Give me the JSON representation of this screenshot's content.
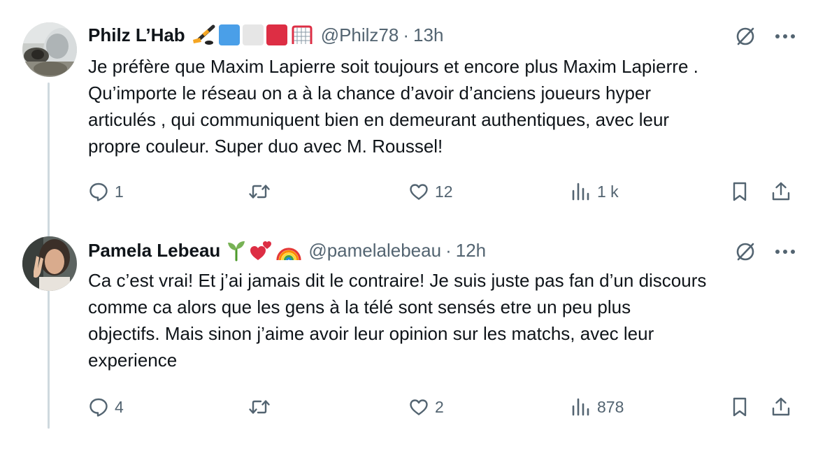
{
  "tweets": [
    {
      "display_name": "Philz L’Hab",
      "name_emojis": [
        "hockey-stick-icon",
        "blue-square",
        "white-square",
        "red-square",
        "hockey-net-icon"
      ],
      "handle": "@Philz78",
      "separator": "·",
      "time": "13h",
      "text": "Je préfère que Maxim Lapierre soit toujours et encore plus Maxim Lapierre .\nQu’importe le réseau on a à la chance d’avoir d’anciens joueurs hyper\narticulés , qui communiquent bien en demeurant authentiques, avec leur\npropre couleur.  Super duo avec M. Roussel!",
      "replies": "1",
      "retweets": "",
      "likes": "12",
      "views": "1 k"
    },
    {
      "display_name": "Pamela Lebeau",
      "name_emojis": [
        "seedling-icon",
        "two-hearts-icon",
        "rainbow-icon"
      ],
      "handle": "@pamelalebeau",
      "separator": "·",
      "time": "12h",
      "text": "Ca c’est vrai! Et j’ai jamais dit le contraire! Je suis juste pas fan d’un discours\ncomme ca alors que les gens à la télé sont sensés etre un peu plus\nobjectifs. Mais sinon j’aime avoir leur opinion sur les matchs, avec leur\nexperience",
      "replies": "4",
      "retweets": "",
      "likes": "2",
      "views": "878"
    }
  ],
  "colors": {
    "text": "#0f1419",
    "secondary": "#536471",
    "thread_line": "#cfd9de",
    "blue_square": "#4a9fe8",
    "white_square": "#e6e6e6",
    "red_square": "#dd2e44"
  }
}
